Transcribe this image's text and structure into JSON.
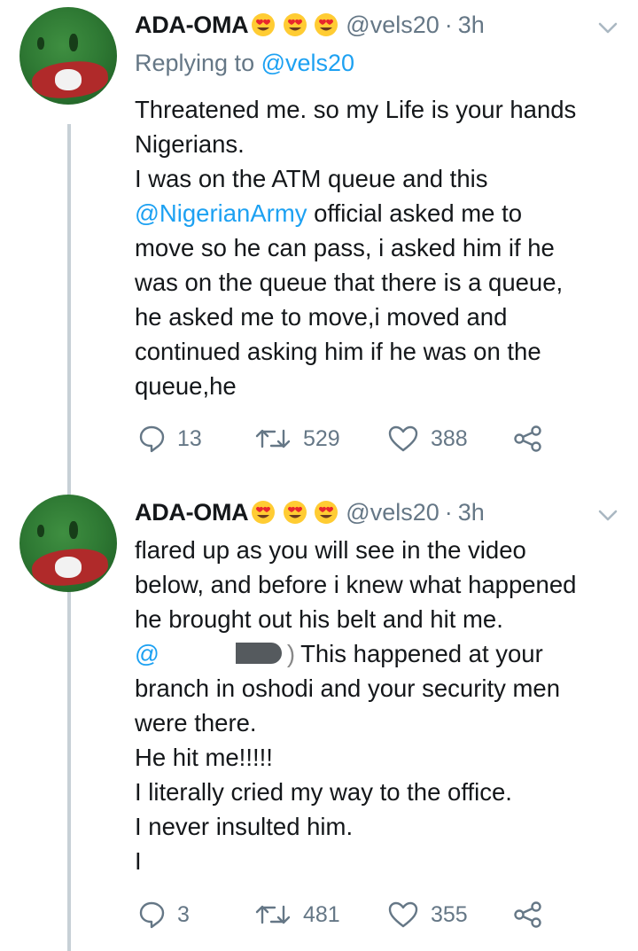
{
  "tweets": [
    {
      "name": "ADA-OMA",
      "handle": "@vels20",
      "separator": "·",
      "time": "3h",
      "replying_prefix": "Replying to ",
      "replying_to": "@vels20",
      "lines": [
        "Threatened me. so my Life is your hands",
        "Nigerians.",
        "I was on the ATM queue and this",
        {
          "mention": "@NigerianArmy",
          "rest": " official asked me to"
        },
        "move so he can pass, i asked him if he",
        "was on the queue that there is a queue,",
        "he asked me to move,i moved and",
        "continued asking him if he was on the",
        "queue,he"
      ],
      "replies": "13",
      "retweets": "529",
      "likes": "388"
    },
    {
      "name": "ADA-OMA",
      "handle": "@vels20",
      "separator": "·",
      "time": "3h",
      "lines": [
        "flared up as you will see in the video",
        "below, and before i knew what happened",
        "he brought out his belt and hit me.",
        {
          "mention": "@",
          "paren": ")",
          "rest": "This happened at your"
        },
        "branch in oshodi and your security men",
        "were there.",
        "He hit me!!!!!",
        "I literally cried my way to the office.",
        "I never insulted him.",
        "I"
      ],
      "replies": "3",
      "retweets": "481",
      "likes": "355"
    }
  ],
  "icons": {
    "emoji": "heart-eyes-emoji",
    "reply": "reply-icon",
    "retweet": "retweet-icon",
    "like": "heart-icon",
    "share": "share-icon",
    "menu": "chevron-down-icon"
  },
  "colors": {
    "link": "#1da1f2",
    "muted": "#657786",
    "text": "#14171a",
    "thread_line": "#c7d0d6"
  }
}
